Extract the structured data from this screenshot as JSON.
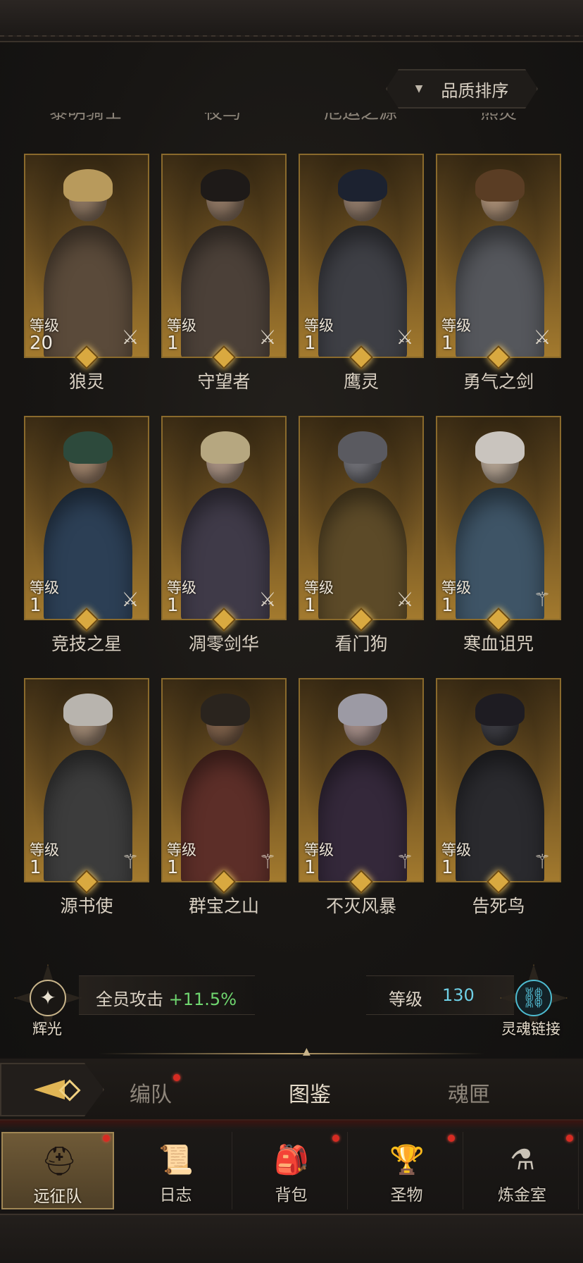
{
  "sort_button": {
    "label": "品质排序"
  },
  "cut_off_names": [
    "黎明骑士",
    "夜鸟",
    "厄运之源",
    "熊灵"
  ],
  "heroes": [
    {
      "name": "狼灵",
      "level_label": "等级",
      "level": "20",
      "class_icon": "sword-icon",
      "hair": "#b89a5c",
      "skin": "#8a7460",
      "body": "#5a4a3a"
    },
    {
      "name": "守望者",
      "level_label": "等级",
      "level": "1",
      "class_icon": "sword-icon",
      "hair": "#1e1a18",
      "skin": "#8c7562",
      "body": "#4b4038"
    },
    {
      "name": "鹰灵",
      "level_label": "等级",
      "level": "1",
      "class_icon": "sword-icon",
      "hair": "#1c2230",
      "skin": "#8d7868",
      "body": "#3e3f45"
    },
    {
      "name": "勇气之剑",
      "level_label": "等级",
      "level": "1",
      "class_icon": "sword-icon",
      "hair": "#5a3d24",
      "skin": "#a48a72",
      "body": "#55575c"
    },
    {
      "name": "竞技之星",
      "level_label": "等级",
      "level": "1",
      "class_icon": "sword-icon",
      "hair": "#2d4a3c",
      "skin": "#9a7f68",
      "body": "#2c3f55"
    },
    {
      "name": "凋零剑华",
      "level_label": "等级",
      "level": "1",
      "class_icon": "sword-icon",
      "hair": "#b6a780",
      "skin": "#a58f80",
      "body": "#3f3a48"
    },
    {
      "name": "看门狗",
      "level_label": "等级",
      "level": "1",
      "class_icon": "sword-icon",
      "hair": "#5a5a60",
      "skin": "#6e6e74",
      "body": "#5c4a28"
    },
    {
      "name": "寒血诅咒",
      "level_label": "等级",
      "level": "1",
      "class_icon": "staff-icon",
      "hair": "#c9c4be",
      "skin": "#b0a090",
      "body": "#3e5466"
    },
    {
      "name": "源书使",
      "level_label": "等级",
      "level": "1",
      "class_icon": "staff-icon",
      "hair": "#b8b4ae",
      "skin": "#9a8470",
      "body": "#3c3c3c"
    },
    {
      "name": "群宝之山",
      "level_label": "等级",
      "level": "1",
      "class_icon": "staff-icon",
      "hair": "#2a241e",
      "skin": "#7a5e48",
      "body": "#5c2e28"
    },
    {
      "name": "不灭风暴",
      "level_label": "等级",
      "level": "1",
      "class_icon": "staff-icon",
      "hair": "#9c9aa4",
      "skin": "#a08a84",
      "body": "#34283a"
    },
    {
      "name": "告死鸟",
      "level_label": "等级",
      "level": "1",
      "class_icon": "staff-icon",
      "hair": "#1e1c22",
      "skin": "#3a3a40",
      "body": "#2a2a2e"
    }
  ],
  "bonus": {
    "emblem_label": "辉光",
    "text": "全员攻击",
    "value": "+11.5%"
  },
  "soul_link": {
    "level_label": "等级",
    "level_value": "130",
    "emblem_label": "灵魂链接"
  },
  "sub_tabs": [
    {
      "label": "编队",
      "badge": true
    },
    {
      "label": "图鉴",
      "active": true
    },
    {
      "label": "魂匣"
    }
  ],
  "bottom_nav": [
    {
      "label": "远征队",
      "icon": "helmet-icon",
      "active": true,
      "badge": true
    },
    {
      "label": "日志",
      "icon": "scroll-icon"
    },
    {
      "label": "背包",
      "icon": "backpack-icon",
      "badge": true
    },
    {
      "label": "圣物",
      "icon": "chalice-icon",
      "badge": true
    },
    {
      "label": "炼金室",
      "icon": "alchemy-icon",
      "badge": true
    }
  ],
  "colors": {
    "frame_gold": "#8a6a2c",
    "bonus_green": "#6fd66f",
    "soul_cyan": "#6fd0e6",
    "badge_red": "#d62b22"
  }
}
